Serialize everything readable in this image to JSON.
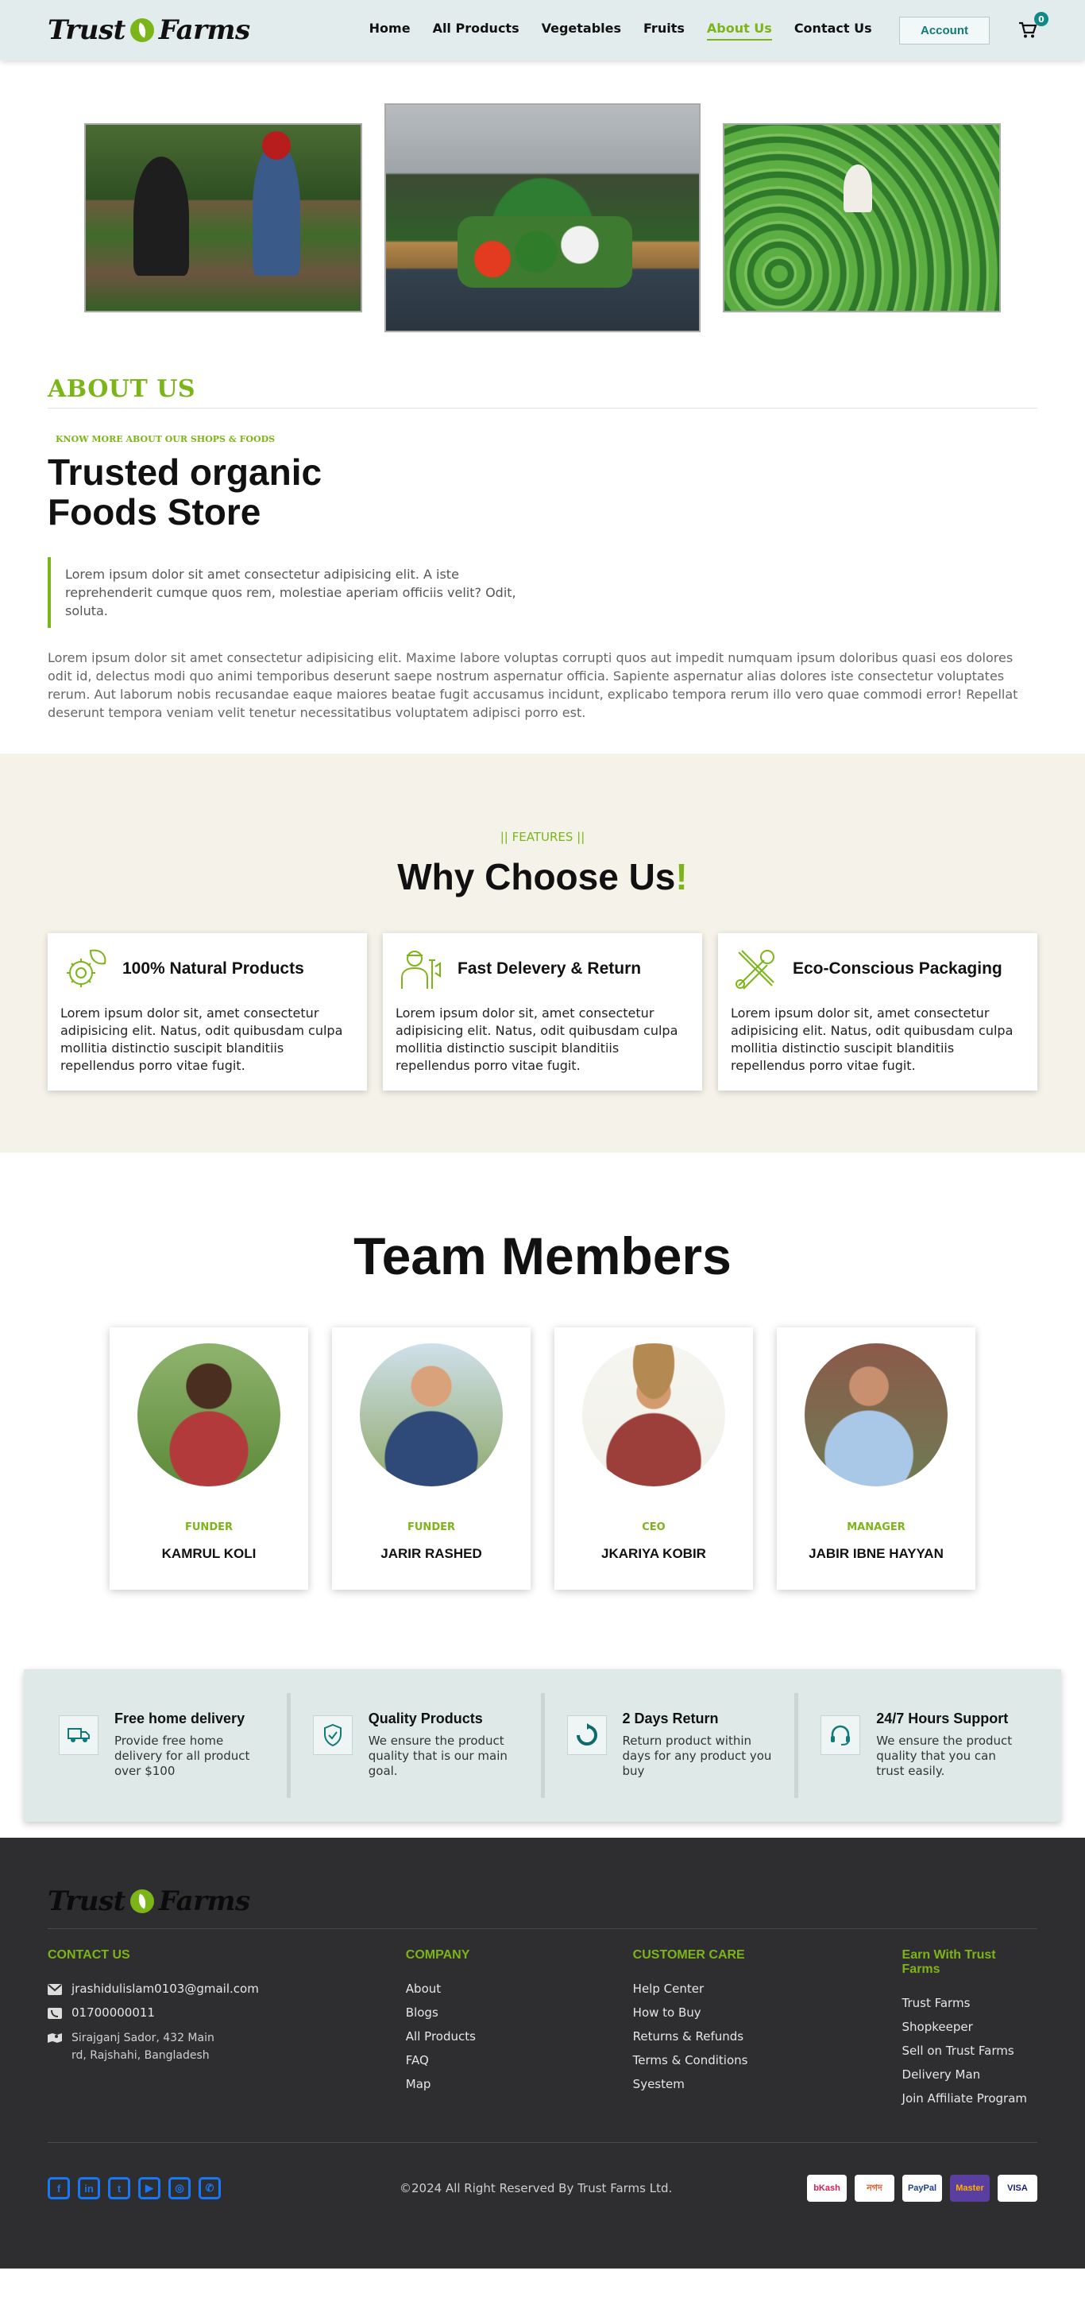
{
  "nav": {
    "logo_left": "Trust",
    "logo_right": "Farms",
    "links": [
      "Home",
      "All Products",
      "Vegetables",
      "Fruits",
      "About Us",
      "Contact Us"
    ],
    "account_label": "Account",
    "cart_count": "0"
  },
  "about": {
    "heading": "ABOUT US",
    "kicker": "KNOW MORE ABOUT OUR SHOPS & FOODS",
    "title": "Trusted organic Foods Store",
    "quote": "Lorem ipsum dolor sit amet consectetur adipisicing elit. A iste reprehenderit cumque quos rem, molestiae aperiam officiis velit? Odit, soluta.",
    "body": "Lorem ipsum dolor sit amet consectetur adipisicing elit. Maxime labore voluptas corrupti quos aut impedit numquam ipsum doloribus quasi eos dolores odit id, delectus modi quo animi temporibus deserunt saepe nostrum aspernatur officia. Sapiente aspernatur alias dolores iste consectetur voluptates rerum. Aut laborum nobis recusandae eaque maiores beatae fugit accusamus incidunt, explicabo tempora rerum illo vero quae commodi error! Repellat deserunt tempora veniam velit tenetur necessitatibus voluptatem adipisci porro est."
  },
  "features": {
    "kicker": "|| FEATURES ||",
    "title": "Why Choose Us",
    "title_mark": "!",
    "cards": [
      {
        "title": "100% Natural Products",
        "desc": "Lorem ipsum dolor sit, amet consectetur adipisicing elit. Natus, odit quibusdam culpa mollitia distinctio suscipit blanditiis repellendus porro vitae fugit.",
        "icon": "gear-leaf-icon"
      },
      {
        "title": "Fast Delevery & Return",
        "desc": "Lorem ipsum dolor sit, amet consectetur adipisicing elit. Natus, odit quibusdam culpa mollitia distinctio suscipit blanditiis repellendus porro vitae fugit.",
        "icon": "delivery-worker-icon"
      },
      {
        "title": "Eco-Conscious Packaging",
        "desc": "Lorem ipsum dolor sit, amet consectetur adipisicing elit. Natus, odit quibusdam culpa mollitia distinctio suscipit blanditiis repellendus porro vitae fugit.",
        "icon": "tools-icon"
      }
    ]
  },
  "team": {
    "title": "Team Members",
    "members": [
      {
        "role": "FUNDER",
        "name": "KAMRUL KOLI"
      },
      {
        "role": "FUNDER",
        "name": "JARIR RASHED"
      },
      {
        "role": "CEO",
        "name": "JKARIYA KOBIR"
      },
      {
        "role": "MANAGER",
        "name": "JABIR IBNE HAYYAN"
      }
    ]
  },
  "services": [
    {
      "title": "Free home delivery",
      "desc": "Provide free home delivery for all product over $100",
      "icon": "truck-icon"
    },
    {
      "title": "Quality Products",
      "desc": "We ensure the product quality that is our main goal.",
      "icon": "shield-check-icon"
    },
    {
      "title": "2 Days Return",
      "desc": "Return product within days for any product you buy",
      "icon": "return-icon"
    },
    {
      "title": "24/7 Hours Support",
      "desc": "We ensure the product quality that you can trust easily.",
      "icon": "headset-icon"
    }
  ],
  "footer": {
    "contact_heading": "CONTACT US",
    "email": "jrashidulislam0103@gmail.com",
    "phone": "01700000011",
    "address": "Sirajganj Sador, 432 Main rd, Rajshahi, Bangladesh",
    "company_heading": "COMPANY",
    "company_links": [
      "About",
      "Blogs",
      "All Products",
      "FAQ",
      "Map"
    ],
    "care_heading": "CUSTOMER CARE",
    "care_links": [
      "Help Center",
      "How to Buy",
      "Returns & Refunds",
      "Terms & Conditions",
      "Syestem"
    ],
    "earn_heading": "Earn With Trust Farms",
    "earn_links": [
      "Trust Farms",
      "Shopkeeper",
      "Sell on Trust Farms",
      "Delivery Man",
      "Join Affiliate Program"
    ],
    "copyright": "©2024 All Right Reserved By Trust Farms Ltd.",
    "social_icons": [
      "f",
      "in",
      "t",
      "▶",
      "◎",
      "✆"
    ],
    "payments": [
      {
        "label": "bKash",
        "bg": "#ffffff",
        "color": "#d12053"
      },
      {
        "label": "নগদ",
        "bg": "#ffffff",
        "color": "#e84b1a"
      },
      {
        "label": "PayPal",
        "bg": "#ffffff",
        "color": "#1f3d8b"
      },
      {
        "label": "Master",
        "bg": "#5a3ea0",
        "color": "#ffb100"
      },
      {
        "label": "VISA",
        "bg": "#ffffff",
        "color": "#1a1f71"
      }
    ]
  },
  "colors": {
    "accent": "#7cb518",
    "teal": "#0f7a78",
    "footer_bg": "#2e2e30",
    "features_bg": "#f5f2ea",
    "services_bg": "#dfeae8"
  }
}
